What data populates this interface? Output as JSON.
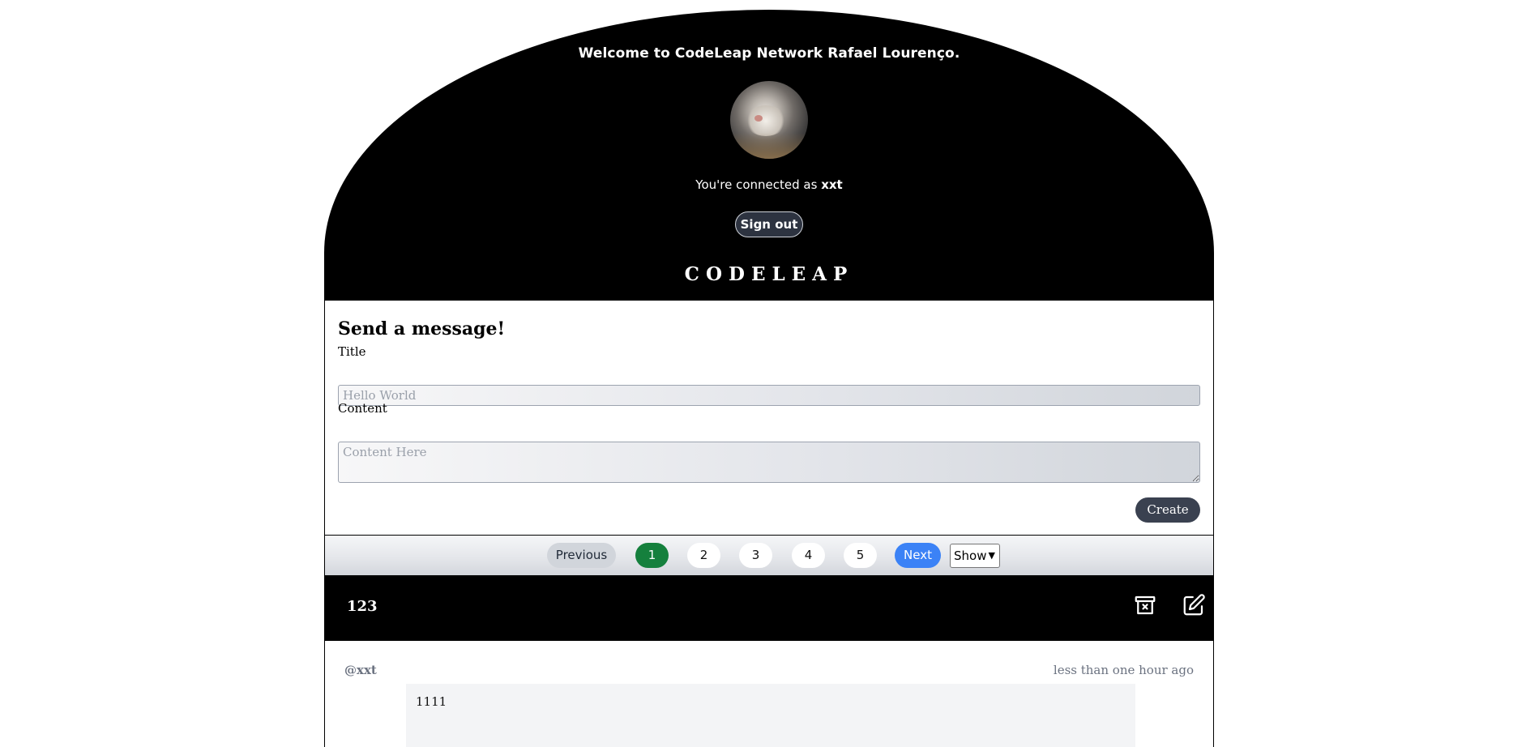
{
  "header": {
    "welcome": "Welcome to CodeLeap Network Rafael Lourenço.",
    "connected_prefix": "You're connected as ",
    "username": "xxt",
    "signout_label": "Sign out",
    "brand": "CODELEAP"
  },
  "form": {
    "heading": "Send a message!",
    "title_label": "Title",
    "title_placeholder": "Hello World",
    "content_label": "Content",
    "content_placeholder": "Content Here",
    "create_label": "Create"
  },
  "pagination": {
    "previous_label": "Previous",
    "pages": [
      "1",
      "2",
      "3",
      "4",
      "5"
    ],
    "active_page": "1",
    "next_label": "Next",
    "show_label": "Show"
  },
  "post": {
    "title": "123",
    "author": "@xxt",
    "time": "less than one hour ago",
    "content": "1111",
    "icons": {
      "delete": "archive-x-icon",
      "edit": "edit-icon"
    }
  },
  "colors": {
    "header_bg": "#000000",
    "active_page": "#15803d",
    "next_button": "#3b82f6",
    "create_button": "#3a4150"
  }
}
